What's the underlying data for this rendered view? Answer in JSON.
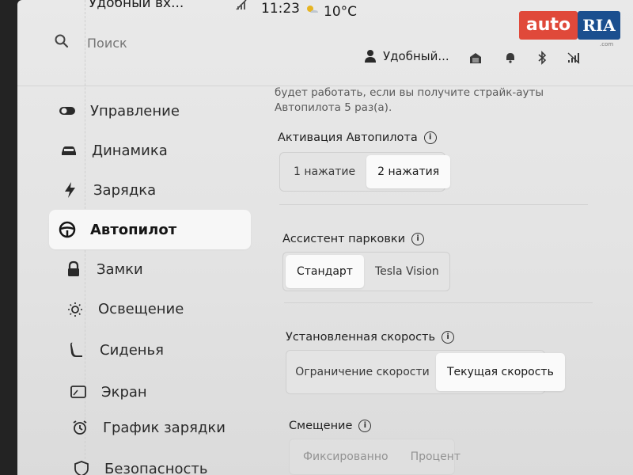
{
  "status_bar": {
    "location": "Удобный вх...",
    "time": "11:23",
    "temperature": "10°C"
  },
  "search": {
    "placeholder": "Поиск"
  },
  "header": {
    "user_name": "Удобный..."
  },
  "sidebar": {
    "items": [
      {
        "label": "Управление",
        "icon": "toggle-icon"
      },
      {
        "label": "Динамика",
        "icon": "car-icon"
      },
      {
        "label": "Зарядка",
        "icon": "lightning-icon"
      },
      {
        "label": "Автопилот",
        "icon": "steering-wheel-icon",
        "active": true
      },
      {
        "label": "Замки",
        "icon": "lock-icon"
      },
      {
        "label": "Освещение",
        "icon": "sun-icon"
      },
      {
        "label": "Сиденья",
        "icon": "seat-icon"
      },
      {
        "label": "Экран",
        "icon": "screen-icon"
      },
      {
        "label": "График зарядки",
        "icon": "alarm-clock-icon"
      },
      {
        "label": "Безопасность",
        "icon": "shield-icon"
      }
    ]
  },
  "content": {
    "note": "будет работать, если вы получите страйк-ауты Автопилота 5 раз(а).",
    "autopilot_activation": {
      "title": "Активация Автопилота",
      "options": [
        "1 нажатие",
        "2 нажатия"
      ],
      "selected": "2 нажатия"
    },
    "parking_assist": {
      "title": "Ассистент парковки",
      "options": [
        "Стандарт",
        "Tesla Vision"
      ],
      "selected": "Стандарт"
    },
    "set_speed": {
      "title": "Установленная скорость",
      "options": [
        "Ограничение скорости",
        "Текущая скорость"
      ],
      "selected": "Текущая скорость"
    },
    "offset": {
      "title": "Смещение",
      "options": [
        "Фиксированно",
        "Процент"
      ]
    }
  },
  "watermark": {
    "auto": "auto",
    "ria": "RIA",
    "com": ".com"
  },
  "colors": {
    "accent_red": "#e0493a",
    "accent_blue": "#1b4f8f",
    "active_bg": "#f7f7f7"
  }
}
